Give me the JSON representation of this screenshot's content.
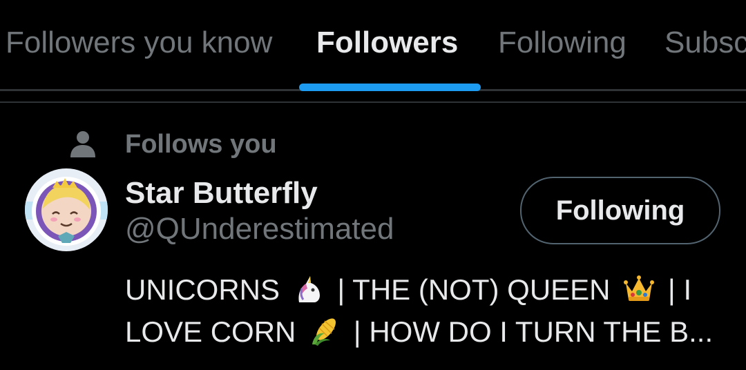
{
  "tabs": [
    {
      "label": "Followers you know",
      "active": false
    },
    {
      "label": "Followers",
      "active": true
    },
    {
      "label": "Following",
      "active": false
    },
    {
      "label": "Subsc",
      "active": false
    }
  ],
  "accent_color": "#1d9bf0",
  "social_context": {
    "icon": "person-icon",
    "label": "Follows you"
  },
  "user": {
    "display_name": "Star Butterfly",
    "handle": "@QUnderestimated",
    "avatar": "star-butterfly-avatar",
    "follow_button_label": "Following",
    "bio": {
      "line1": {
        "part1": "UNICORNS",
        "emoji1": "unicorn-emoji",
        "part2": "| THE (NOT) QUEEN",
        "emoji2": "crown-emoji",
        "part3": "| I"
      },
      "line2": {
        "part1": "LOVE CORN",
        "emoji1": "corn-emoji",
        "part2": "| HOW DO I TURN THE B..."
      }
    }
  },
  "colors": {
    "background": "#000000",
    "primary_text": "#e7e9ea",
    "secondary_text": "#71767b",
    "divider": "#2f3336",
    "button_border": "#536471"
  }
}
